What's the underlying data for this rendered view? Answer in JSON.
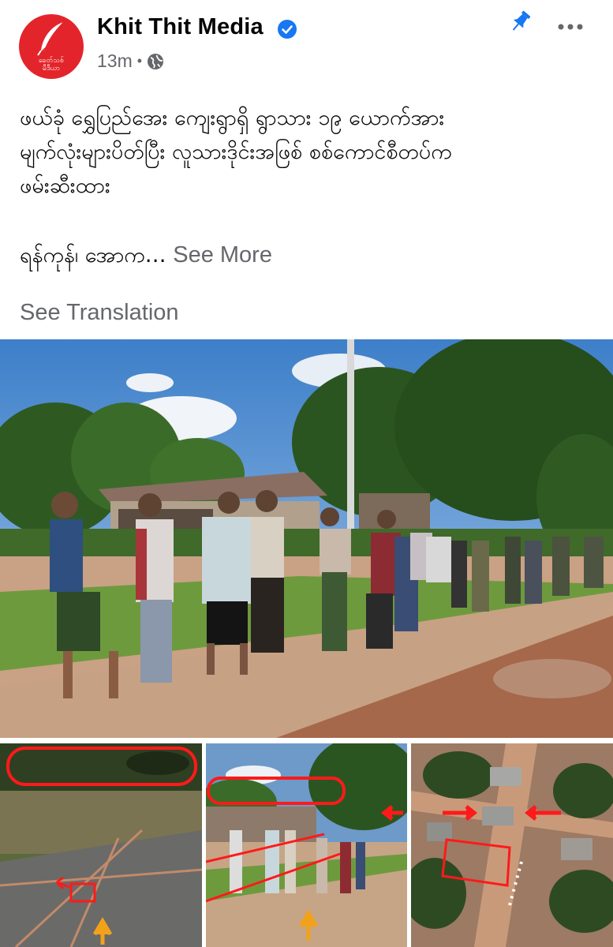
{
  "page": {
    "name": "Khit Thit Media",
    "time": "13m",
    "dot": "•",
    "avatar_text_line1": "ခေတ်သစ်",
    "avatar_text_line2": "မီဒီယာ"
  },
  "post": {
    "lines": [
      "ဖယ်ခုံ ရွှေပြည်အေး ကျေးရွာရှိ ရွာသား ၁၉ ယောက်အား",
      "မျက်လုံးများပိတ်ပြီး လူသားဒိုင်းအဖြစ် စစ်ကောင်စီတပ်က",
      "ဖမ်းဆီးထား"
    ],
    "truncated": "ရန်ကုန်၊ အောက…",
    "see_more": "See More",
    "see_translation": "See Translation"
  },
  "icons": {
    "verified": "verified-badge-icon",
    "globe": "globe-icon",
    "pin": "pin-icon",
    "more": "more-options-icon"
  },
  "colors": {
    "brand_red": "#e3252b",
    "facebook_blue": "#1877f2",
    "secondary_text": "#65676b",
    "highlight_red": "#ff1a1a"
  }
}
